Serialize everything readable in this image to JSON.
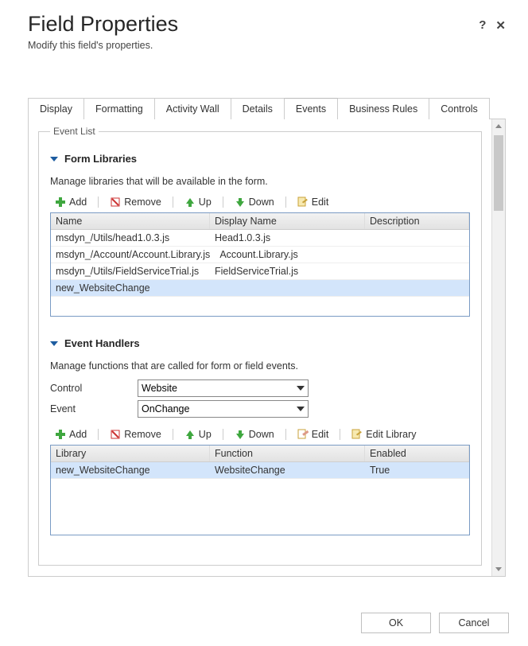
{
  "header": {
    "title": "Field Properties",
    "subtitle": "Modify this field's properties.",
    "help": "?",
    "close": "✕"
  },
  "tabs": [
    "Display",
    "Formatting",
    "Activity Wall",
    "Details",
    "Events",
    "Business Rules",
    "Controls"
  ],
  "active_tab": "Events",
  "fieldset_legend": "Event List",
  "form_libraries": {
    "title": "Form Libraries",
    "desc": "Manage libraries that will be available in the form.",
    "toolbar": {
      "add": "Add",
      "remove": "Remove",
      "up": "Up",
      "down": "Down",
      "edit": "Edit"
    },
    "columns": {
      "name": "Name",
      "display": "Display Name",
      "desc": "Description"
    },
    "rows": [
      {
        "name": "msdyn_/Utils/head1.0.3.js",
        "display": "Head1.0.3.js",
        "desc": ""
      },
      {
        "name": "msdyn_/Account/Account.Library.js",
        "display": "Account.Library.js",
        "desc": ""
      },
      {
        "name": "msdyn_/Utils/FieldServiceTrial.js",
        "display": "FieldServiceTrial.js",
        "desc": ""
      },
      {
        "name": "new_WebsiteChange",
        "display": "",
        "desc": ""
      }
    ],
    "selected_row": 3
  },
  "event_handlers": {
    "title": "Event Handlers",
    "desc": "Manage functions that are called for form or field events.",
    "control_label": "Control",
    "control_value": "Website",
    "event_label": "Event",
    "event_value": "OnChange",
    "toolbar": {
      "add": "Add",
      "remove": "Remove",
      "up": "Up",
      "down": "Down",
      "edit": "Edit",
      "edit_library": "Edit Library"
    },
    "columns": {
      "lib": "Library",
      "fn": "Function",
      "en": "Enabled"
    },
    "rows": [
      {
        "lib": "new_WebsiteChange",
        "fn": "WebsiteChange",
        "en": "True"
      }
    ]
  },
  "footer": {
    "ok": "OK",
    "cancel": "Cancel"
  }
}
